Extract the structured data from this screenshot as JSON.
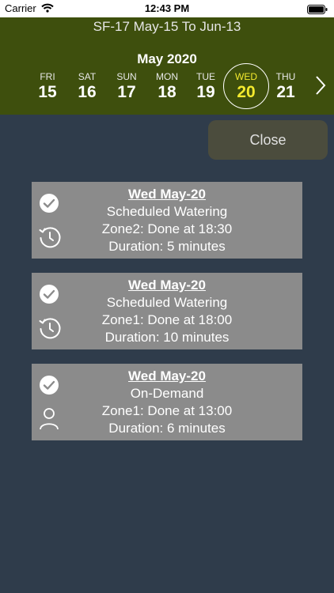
{
  "status_bar": {
    "carrier": "Carrier",
    "time": "12:43 PM"
  },
  "header": {
    "title": "SF-17 May-15 To Jun-13",
    "month": "May 2020",
    "days": [
      {
        "name": "FRI",
        "num": "15",
        "selected": false
      },
      {
        "name": "SAT",
        "num": "16",
        "selected": false
      },
      {
        "name": "SUN",
        "num": "17",
        "selected": false
      },
      {
        "name": "MON",
        "num": "18",
        "selected": false
      },
      {
        "name": "TUE",
        "num": "19",
        "selected": false
      },
      {
        "name": "WED",
        "num": "20",
        "selected": true
      },
      {
        "name": "THU",
        "num": "21",
        "selected": false
      }
    ]
  },
  "close_label": "Close",
  "events": [
    {
      "date": "Wed May-20",
      "type": "Scheduled Watering",
      "status": "Zone2: Done at 18:30",
      "duration": "Duration: 5 minutes",
      "status_icon": "checkmark-circle-icon",
      "kind_icon": "clock-icon"
    },
    {
      "date": "Wed May-20",
      "type": "Scheduled Watering",
      "status": "Zone1: Done at 18:00",
      "duration": "Duration: 10 minutes",
      "status_icon": "checkmark-circle-icon",
      "kind_icon": "clock-icon"
    },
    {
      "date": "Wed May-20",
      "type": "On-Demand",
      "status": "Zone1: Done at 13:00",
      "duration": "Duration: 6 minutes",
      "status_icon": "checkmark-circle-icon",
      "kind_icon": "person-icon"
    }
  ],
  "colors": {
    "background": "#2f3c4b",
    "header": "#3e4f0d",
    "selected_day": "#f3ea2e",
    "card": "#8b8b8b"
  }
}
